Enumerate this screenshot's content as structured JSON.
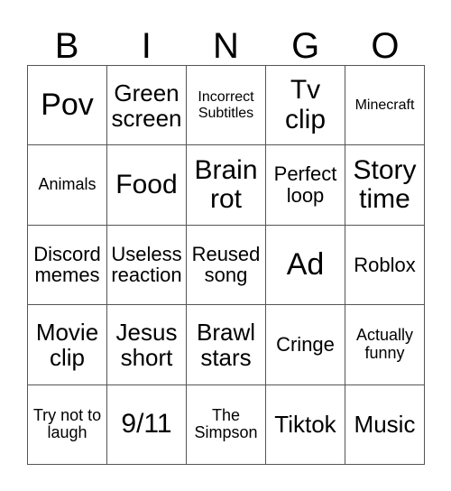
{
  "card": {
    "title": "BINGO card",
    "headers": [
      "B",
      "I",
      "N",
      "G",
      "O"
    ],
    "grid_size": "5x5",
    "colors": {
      "background": "#ffffff",
      "text": "#000000",
      "border": "#555555"
    },
    "rows": [
      [
        {
          "label": "Pov",
          "size": "xxl"
        },
        {
          "label": "Green screen",
          "size": "lg"
        },
        {
          "label": "Incorrect Subtitles",
          "size": "xs"
        },
        {
          "label": "Tv clip",
          "size": "xl"
        },
        {
          "label": "Minecraft",
          "size": "xs"
        }
      ],
      [
        {
          "label": "Animals",
          "size": "sm"
        },
        {
          "label": "Food",
          "size": "xl"
        },
        {
          "label": "Brain rot",
          "size": "xl"
        },
        {
          "label": "Perfect loop",
          "size": "md"
        },
        {
          "label": "Story time",
          "size": "xl"
        }
      ],
      [
        {
          "label": "Discord memes",
          "size": "md"
        },
        {
          "label": "Useless reaction",
          "size": "md"
        },
        {
          "label": "Reused song",
          "size": "md"
        },
        {
          "label": "Ad",
          "size": "xxl"
        },
        {
          "label": "Roblox",
          "size": "md"
        }
      ],
      [
        {
          "label": "Movie clip",
          "size": "lg"
        },
        {
          "label": "Jesus short",
          "size": "lg"
        },
        {
          "label": "Brawl stars",
          "size": "lg"
        },
        {
          "label": "Cringe",
          "size": "md"
        },
        {
          "label": "Actually funny",
          "size": "sm"
        }
      ],
      [
        {
          "label": "Try not to laugh",
          "size": "sm"
        },
        {
          "label": "9/11",
          "size": "xl"
        },
        {
          "label": "The Simpson",
          "size": "sm"
        },
        {
          "label": "Tiktok",
          "size": "lg"
        },
        {
          "label": "Music",
          "size": "lg"
        }
      ]
    ]
  }
}
